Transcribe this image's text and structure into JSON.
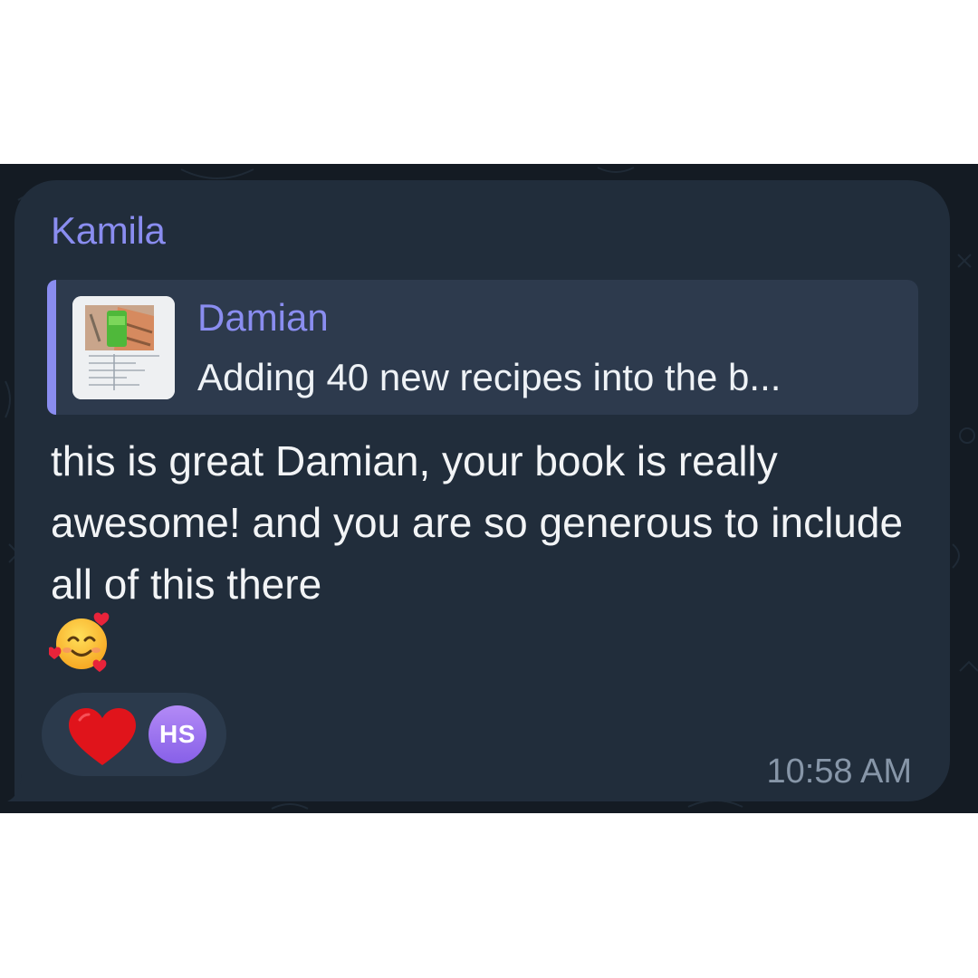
{
  "message": {
    "sender_name": "Kamila",
    "reply": {
      "author": "Damian",
      "preview_text": "Adding 40 new recipes into the b...",
      "thumbnail_icon": "recipe-page-thumbnail"
    },
    "text": "this is great Damian, your book is really awesome! and you are so generous to include all of this there",
    "emoji": "smiling-face-with-hearts-icon",
    "time": "10:58 AM"
  },
  "reactions": {
    "emoji": "red-heart-icon",
    "user_initials": "HS"
  },
  "colors": {
    "wallpaper": "#141b23",
    "bubble": "#212d3b",
    "reply_background": "#2d3a4d",
    "accent": "#8a8df0",
    "text": "#f2f4f6",
    "time": "#8796a8",
    "avatar": "#9b74ef",
    "heart": "#e0141b"
  }
}
